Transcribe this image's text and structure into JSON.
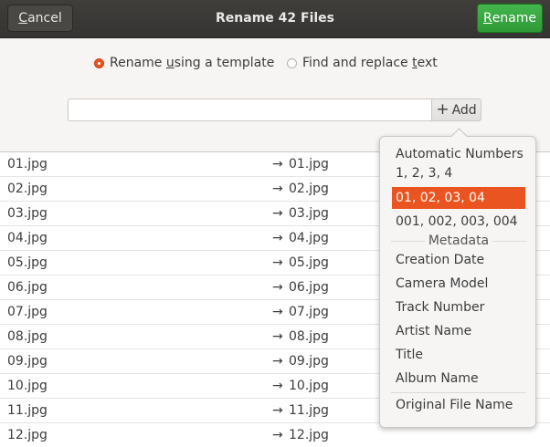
{
  "header": {
    "cancel_label": "Cancel",
    "cancel_mnemonic": "C",
    "cancel_rest": "ancel",
    "title": "Rename 42 Files",
    "rename_mnemonic": "R",
    "rename_rest": "ename",
    "rename_color": "#2e9a36"
  },
  "mode": {
    "template_pre": "Rename ",
    "template_mnemonic": "u",
    "template_post": "sing a template",
    "template_selected": true,
    "replace_pre": "Find and replace ",
    "replace_mnemonic": "t",
    "replace_post": "ext",
    "replace_selected": false
  },
  "template_entry": {
    "value": ""
  },
  "add_button": {
    "label": "Add"
  },
  "files": [
    {
      "original": "01.jpg",
      "arrow": "→",
      "renamed": "01.jpg"
    },
    {
      "original": "02.jpg",
      "arrow": "→",
      "renamed": "02.jpg"
    },
    {
      "original": "03.jpg",
      "arrow": "→",
      "renamed": "03.jpg"
    },
    {
      "original": "04.jpg",
      "arrow": "→",
      "renamed": "04.jpg"
    },
    {
      "original": "05.jpg",
      "arrow": "→",
      "renamed": "05.jpg"
    },
    {
      "original": "06.jpg",
      "arrow": "→",
      "renamed": "06.jpg"
    },
    {
      "original": "07.jpg",
      "arrow": "→",
      "renamed": "07.jpg"
    },
    {
      "original": "08.jpg",
      "arrow": "→",
      "renamed": "08.jpg"
    },
    {
      "original": "09.jpg",
      "arrow": "→",
      "renamed": "09.jpg"
    },
    {
      "original": "10.jpg",
      "arrow": "→",
      "renamed": "10.jpg"
    },
    {
      "original": "11.jpg",
      "arrow": "→",
      "renamed": "11.jpg"
    },
    {
      "original": "12.jpg",
      "arrow": "→",
      "renamed": "12.jpg"
    }
  ],
  "add_menu": {
    "numbers_heading": "Automatic Numbers",
    "numbers_opt1": "1, 2, 3, 4",
    "numbers_opt2": "01, 02, 03, 04",
    "numbers_opt3": "001, 002, 003, 004",
    "metadata_heading": "Metadata",
    "creation_date": "Creation Date",
    "camera_model": "Camera Model",
    "track_number": "Track Number",
    "artist_name": "Artist Name",
    "title": "Title",
    "album_name": "Album Name",
    "original_file_name": "Original File Name",
    "selection_color": "#e95420"
  }
}
